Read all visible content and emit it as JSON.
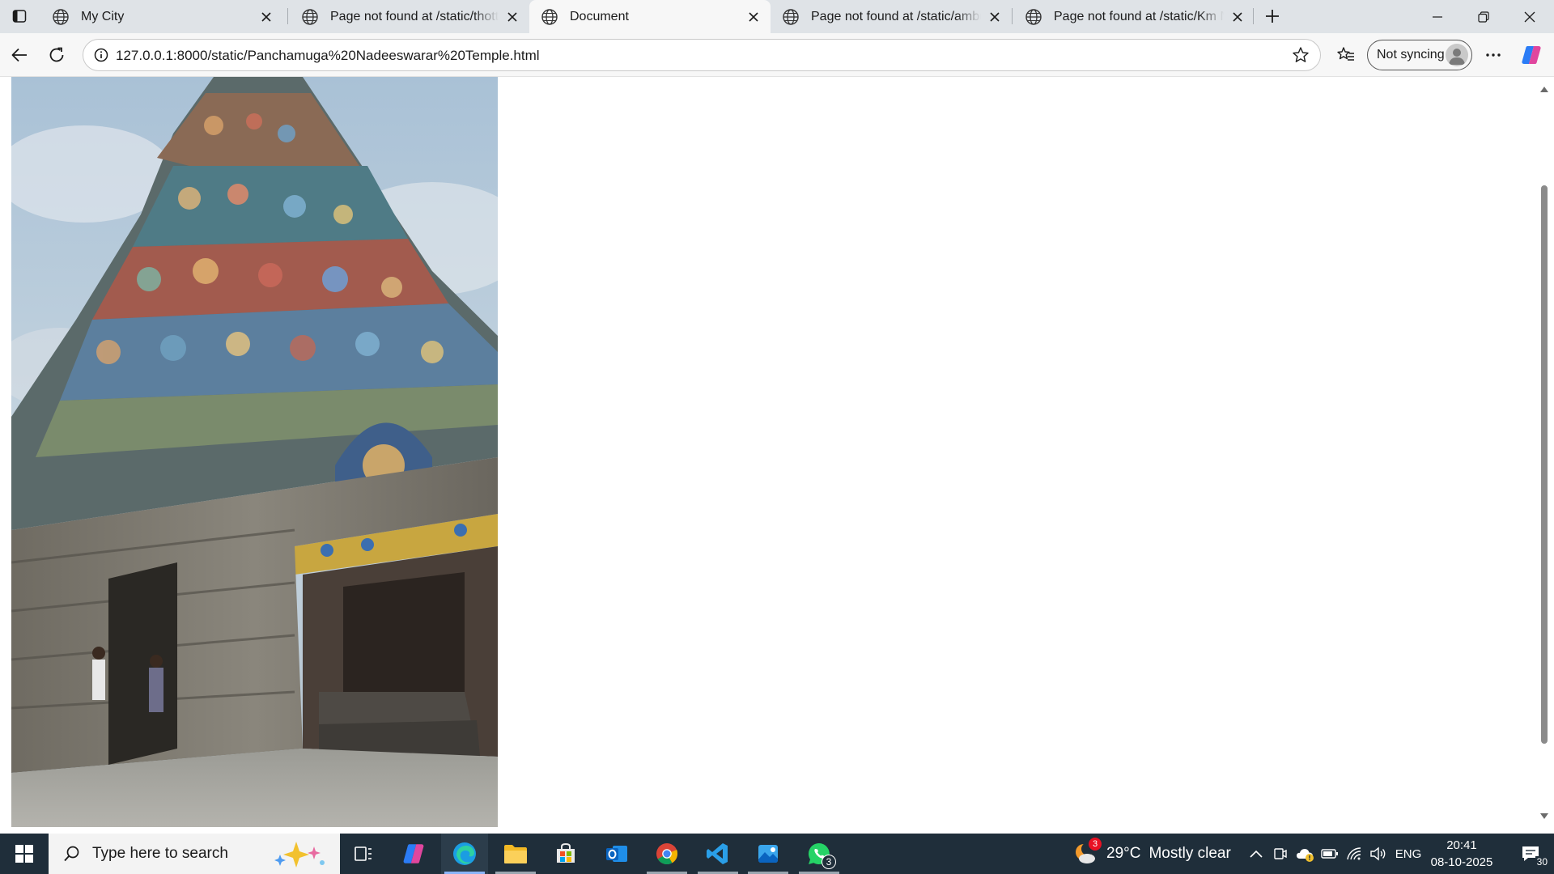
{
  "browser": {
    "tabs": [
      {
        "title": "My City",
        "active": false
      },
      {
        "title": "Page not found at /static/thottrai",
        "active": false
      },
      {
        "title": "Document",
        "active": true
      },
      {
        "title": "Page not found at /static/ambur",
        "active": false
      },
      {
        "title": "Page not found at /static/Km Nu l",
        "active": false
      }
    ],
    "url": "127.0.0.1:8000/static/Panchamuga%20Nadeeswarar%20Temple.html",
    "profile_label": "Not syncing"
  },
  "page": {
    "image_subject": "Temple gopuram photograph"
  },
  "taskbar": {
    "search_placeholder": "Type here to search",
    "apps": [
      {
        "name": "task-view"
      },
      {
        "name": "copilot"
      },
      {
        "name": "edge"
      },
      {
        "name": "file-explorer"
      },
      {
        "name": "microsoft-store"
      },
      {
        "name": "outlook"
      },
      {
        "name": "chrome"
      },
      {
        "name": "vscode"
      },
      {
        "name": "photos"
      },
      {
        "name": "whatsapp",
        "badge": "3"
      }
    ],
    "weather": {
      "temp": "29°C",
      "condition": "Mostly clear",
      "badge": "3"
    },
    "language": "ENG",
    "time": "20:41",
    "date": "08-10-2025",
    "notification_count": "30"
  },
  "colors": {
    "tabstrip_bg": "#dfe3e7",
    "toolbar_bg": "#f7f7f7",
    "taskbar_bg": "#1f2e3a",
    "accent": "#0078d4"
  }
}
